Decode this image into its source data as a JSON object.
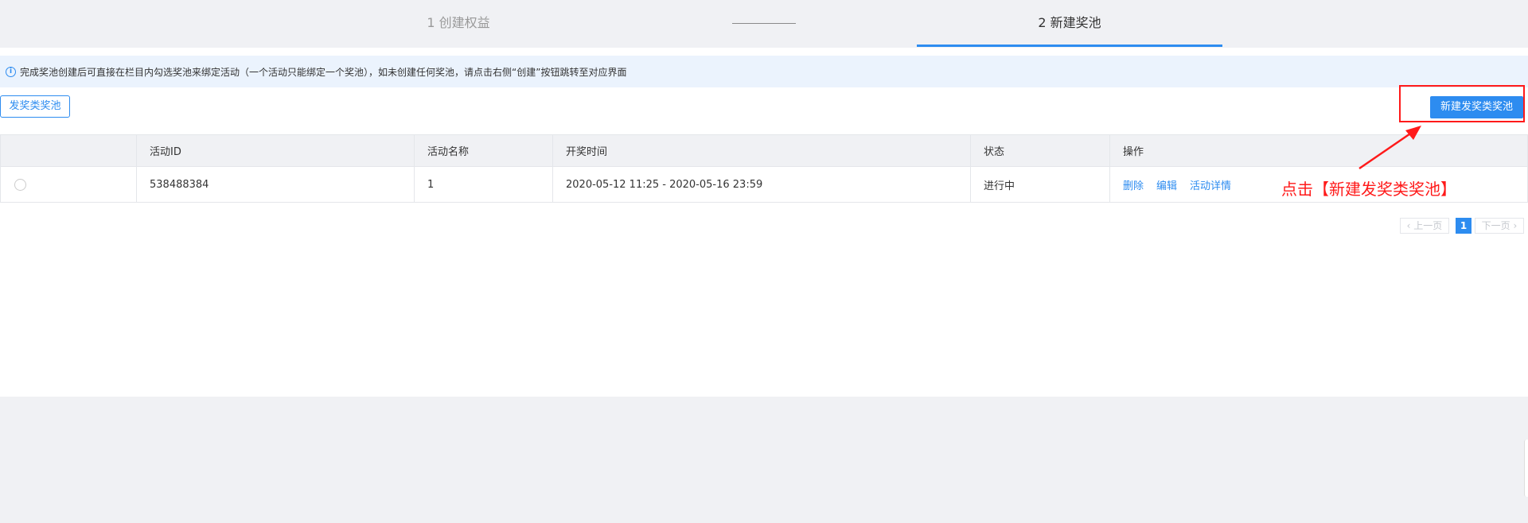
{
  "steps": {
    "step1": "1 创建权益",
    "step2": "2 新建奖池"
  },
  "info": {
    "text": "完成奖池创建后可直接在栏目内勾选奖池来绑定活动（一个活动只能绑定一个奖池），如未创建任何奖池，请点击右侧“创建”按钮跳转至对应界面"
  },
  "toolbar": {
    "tab_label": "发奖类奖池",
    "create_label": "新建发奖类奖池"
  },
  "table": {
    "headers": [
      "",
      "活动ID",
      "活动名称",
      "开奖时间",
      "状态",
      "操作"
    ],
    "rows": [
      {
        "id": "538488384",
        "name": "1",
        "time": "2020-05-12 11:25 - 2020-05-16 23:59",
        "status": "进行中",
        "actions": [
          "删除",
          "编辑",
          "活动详情"
        ]
      }
    ]
  },
  "annotation": {
    "text": "点击【新建发奖类奖池】",
    "color": "#ff1a1a"
  },
  "pagination": {
    "prev": "上一页",
    "current": "1",
    "next": "下一页"
  },
  "colors": {
    "accent": "#2d8cf0",
    "header_bg": "#f0f1f4",
    "info_bg": "#ebf3fd"
  }
}
